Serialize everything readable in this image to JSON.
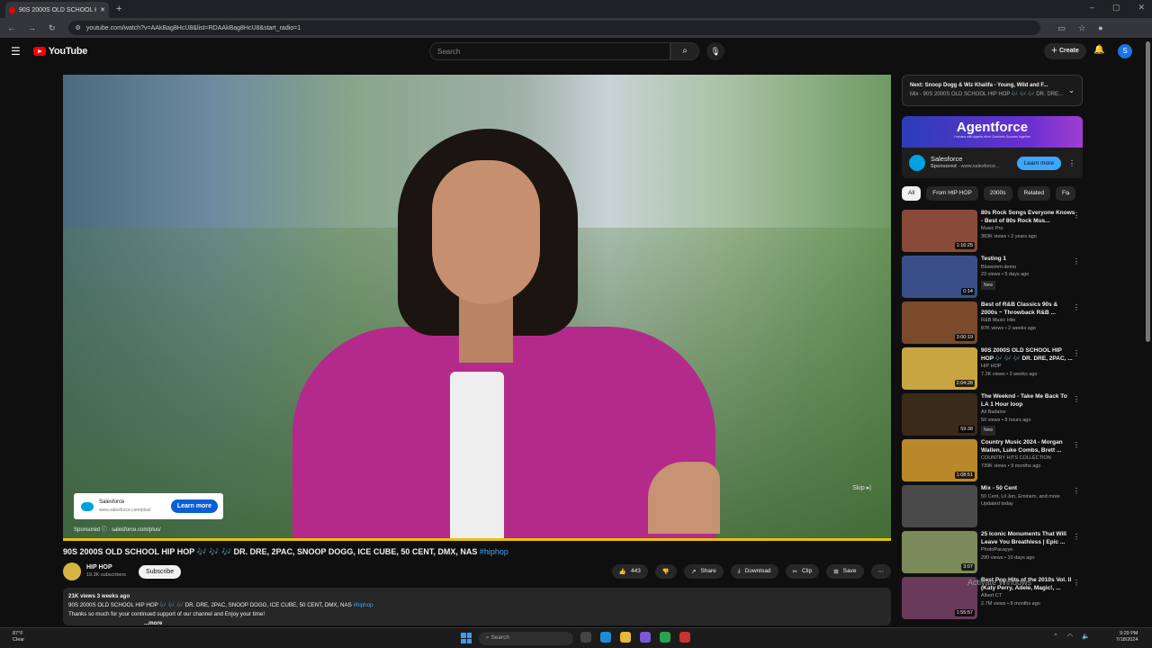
{
  "browser": {
    "tab_title": "90S 2000S OLD SCHOOL H",
    "url": "youtube.com/watch?v=AAkBag8HcU8&list=RDAAkBag8HcU8&start_radio=1"
  },
  "header": {
    "logo_text": "YouTube",
    "search_placeholder": "Search",
    "create_label": "Create",
    "avatar_letter": "S"
  },
  "ad": {
    "brand": "Salesforce",
    "url": "www.salesforce.com/plus/",
    "cta": "Learn more",
    "sponsored": "Sponsored",
    "sponsored_url": "salesforce.com/plus/",
    "skip": "Skip"
  },
  "video": {
    "title": "90S 2000S OLD SCHOOL HIP HOP 🎶 🎶 🎶 DR. DRE, 2PAC, SNOOP DOGG, ICE CUBE, 50 CENT, DMX, NAS",
    "hashtag": "#hiphop",
    "channel": "HIP HOP",
    "subscribers": "19.3K subscribers",
    "subscribe_label": "Subscribe",
    "likes": "443",
    "share": "Share",
    "download": "Download",
    "clip": "Clip",
    "save": "Save",
    "desc_stats": "21K views  3 weeks ago",
    "desc_line1": "90S 2000S OLD SCHOOL HIP HOP 🎶 🎶 🎶 DR. DRE, 2PAC, SNOOP DOGG, ICE CUBE, 50 CENT, DMX, NAS",
    "desc_tag": "#hiphop",
    "desc_line2": "Thanks so much for your continued support of our channel and Enjoy your time!",
    "desc_more": "...more"
  },
  "next": {
    "title": "Next: Snoop Dogg & Wiz Khalifa - Young, Wild and F...",
    "sub": "Mix - 90S 2000S OLD SCHOOL HIP HOP 🎶 🎶 🎶 DR. DRE..."
  },
  "side_ad": {
    "banner": "Agentforce",
    "banner_sub": "Humans with Agents drive Customer Success together",
    "brand": "Salesforce",
    "sponsored": "Sponsored",
    "url": "www.salesforce...",
    "cta": "Learn more"
  },
  "chips": [
    "All",
    "From HIP HOP",
    "2000s",
    "Related",
    "Fo"
  ],
  "recs": [
    {
      "title": "80s Rock Songs Everyone Knows - Best of 80s Rock Mus...",
      "channel": "Music Pro",
      "views": "383K views • 2 years ago",
      "duration": "1:16:25",
      "badge": "",
      "color": "#8a4a3a"
    },
    {
      "title": "Testing 1",
      "channel": "Blowsmm demo",
      "views": "23 views • 5 days ago",
      "duration": "0:14",
      "badge": "New",
      "color": "#3a4f8a"
    },
    {
      "title": "Best of R&B Classics 90s & 2000s ~ Throwback R&B ...",
      "channel": "R&B Music Hits",
      "views": "87K views • 2 weeks ago",
      "duration": "3:00:19",
      "badge": "",
      "color": "#7a4a2a"
    },
    {
      "title": "90S 2000S OLD SCHOOL HIP HOP 🎶 🎶 🎶 DR. DRE, 2PAC, ...",
      "channel": "HIP HOP",
      "views": "7.2K views • 2 weeks ago",
      "duration": "2:04:28",
      "badge": "",
      "color": "#c8a540"
    },
    {
      "title": "The Weeknd - Take Me Back To LA 1 Hour loop",
      "channel": "Ali Badalov",
      "views": "50 views • 8 hours ago",
      "duration": "59:38",
      "badge": "New",
      "color": "#3a2a1a"
    },
    {
      "title": "Country Music 2024 - Morgan Wallen, Luke Combs, Brett ...",
      "channel": "COUNTRY HITS COLLECTION",
      "views": "739K views • 9 months ago",
      "duration": "1:08:51",
      "badge": "",
      "color": "#b8882a"
    },
    {
      "title": "Mix - 50 Cent",
      "channel": "50 Cent, Lil Jon, Eminem, and more",
      "views": "Updated today",
      "duration": "",
      "badge": "",
      "color": "#4a4a4a"
    },
    {
      "title": "25 Iconic Monuments That Will Leave You Breathless | Epic ...",
      "channel": "PhotoPacayye",
      "views": "290 views • 10 days ago",
      "duration": "3:07",
      "badge": "",
      "color": "#7a8a5a"
    },
    {
      "title": "Best Pop Hits of the 2010s Vol. II (Katy Perry, Adele, Magic!, ...",
      "channel": "Albert CT",
      "views": "2.7M views • 8 months ago",
      "duration": "1:55:57",
      "badge": "",
      "color": "#6a3a5a"
    }
  ],
  "windows": {
    "activate": "Activate Windows",
    "weather_temp": "87°F",
    "weather_cond": "Clear",
    "search": "Search",
    "time": "9:29 PM",
    "date": "7/18/2024"
  }
}
